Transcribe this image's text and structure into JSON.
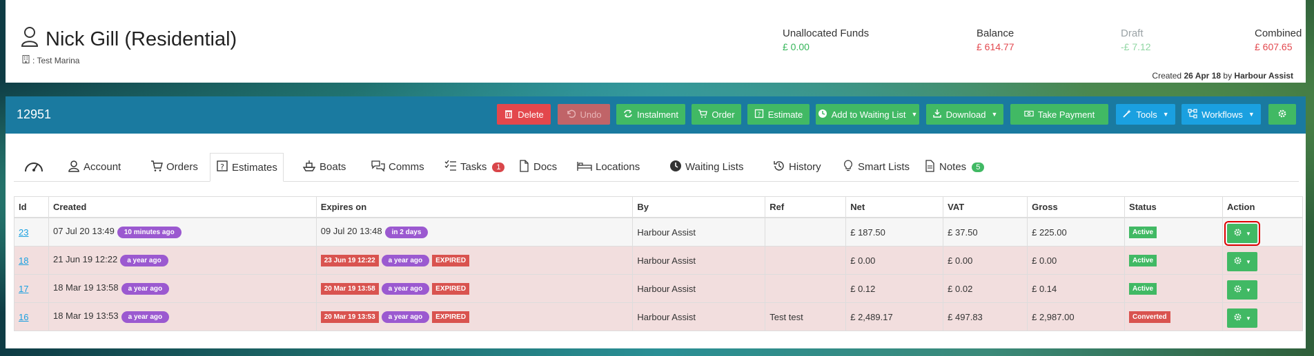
{
  "customer": {
    "name": "Nick Gill (Residential)",
    "marina": ": Test Marina"
  },
  "funds": {
    "unallocated_label": "Unallocated Funds",
    "unallocated_value": "£ 0.00",
    "balance_label": "Balance",
    "balance_value": "£ 614.77",
    "draft_label": "Draft",
    "draft_value": "-£ 7.12",
    "combined_label": "Combined",
    "combined_value": "£ 607.65"
  },
  "created": {
    "prefix": "Created",
    "date": "26 Apr 18",
    "by_word": "by",
    "by": "Harbour Assist"
  },
  "toolbar": {
    "record_id": "12951",
    "delete": "Delete",
    "undo": "Undo",
    "instalment": "Instalment",
    "order": "Order",
    "estimate": "Estimate",
    "add_waiting": "Add to Waiting List",
    "download": "Download",
    "take_payment": "Take Payment",
    "tools": "Tools",
    "workflows": "Workflows"
  },
  "tabs": {
    "account": "Account",
    "orders": "Orders",
    "estimates": "Estimates",
    "boats": "Boats",
    "comms": "Comms",
    "tasks": "Tasks",
    "tasks_count": "1",
    "docs": "Docs",
    "locations": "Locations",
    "waiting_lists": "Waiting Lists",
    "history": "History",
    "smart_lists": "Smart Lists",
    "notes": "Notes",
    "notes_count": "5"
  },
  "table": {
    "headers": [
      "Id",
      "Created",
      "Expires on",
      "By",
      "Ref",
      "Net",
      "VAT",
      "Gross",
      "Status",
      "Action"
    ],
    "rows": [
      {
        "id": "23",
        "created": "07 Jul 20 13:49",
        "created_ago": "10 minutes ago",
        "expires": "09 Jul 20 13:48",
        "expires_rel": "in 2 days",
        "by": "Harbour Assist",
        "ref": "",
        "net": "£ 187.50",
        "vat": "£ 37.50",
        "gross": "£ 225.00",
        "status": "Active"
      },
      {
        "id": "18",
        "created": "21 Jun 19 12:22",
        "created_ago": "a year ago",
        "expires": "23 Jun 19 12:22",
        "expires_rel": "a year ago",
        "expired": "EXPIRED",
        "by": "Harbour Assist",
        "ref": "",
        "net": "£ 0.00",
        "vat": "£ 0.00",
        "gross": "£ 0.00",
        "status": "Active"
      },
      {
        "id": "17",
        "created": "18 Mar 19 13:58",
        "created_ago": "a year ago",
        "expires": "20 Mar 19 13:58",
        "expires_rel": "a year ago",
        "expired": "EXPIRED",
        "by": "Harbour Assist",
        "ref": "",
        "net": "£ 0.12",
        "vat": "£ 0.02",
        "gross": "£ 0.14",
        "status": "Active"
      },
      {
        "id": "16",
        "created": "18 Mar 19 13:53",
        "created_ago": "a year ago",
        "expires": "20 Mar 19 13:53",
        "expires_rel": "a year ago",
        "expired": "EXPIRED",
        "by": "Harbour Assist",
        "ref": "Test test",
        "net": "£ 2,489.17",
        "vat": "£ 497.83",
        "gross": "£ 2,987.00",
        "status": "Converted"
      }
    ]
  },
  "colors": {
    "toolbar_blue": "#1a7aa0",
    "green": "#41b964",
    "red": "#e3474c",
    "blue_button": "#1aa0e0",
    "purple_pill": "#9b59d0"
  }
}
